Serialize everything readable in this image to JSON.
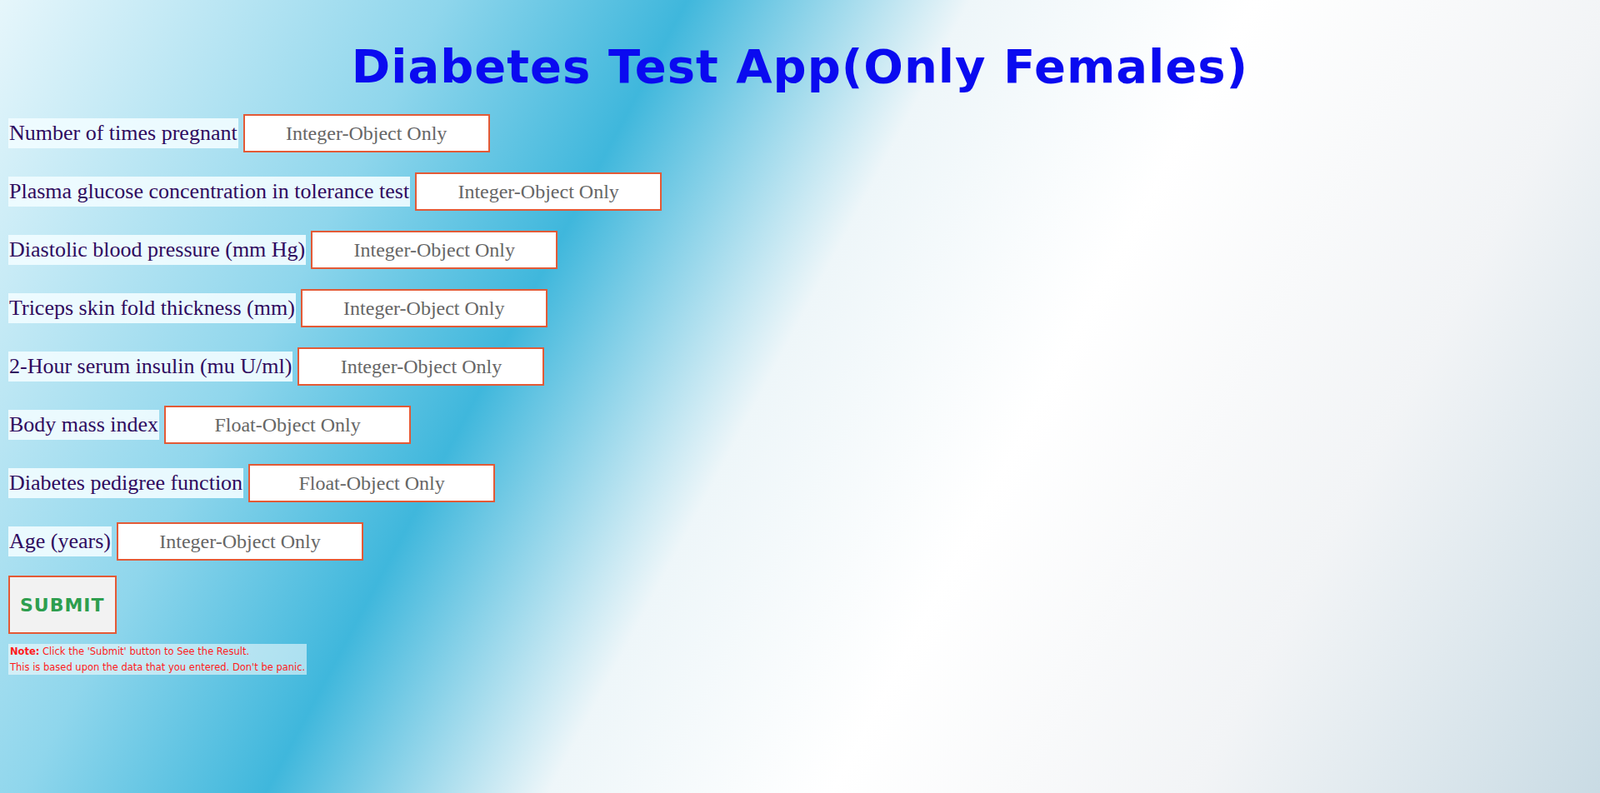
{
  "title": "Diabetes Test App(Only Females)",
  "fields": [
    {
      "label": "Number of times pregnant",
      "placeholder": "Integer-Object Only"
    },
    {
      "label": "Plasma glucose concentration in tolerance test",
      "placeholder": "Integer-Object Only"
    },
    {
      "label": "Diastolic blood pressure (mm Hg)",
      "placeholder": "Integer-Object Only"
    },
    {
      "label": "Triceps skin fold thickness (mm)",
      "placeholder": "Integer-Object Only"
    },
    {
      "label": "2-Hour serum insulin (mu U/ml)",
      "placeholder": "Integer-Object Only"
    },
    {
      "label": "Body mass index",
      "placeholder": "Float-Object Only"
    },
    {
      "label": "Diabetes pedigree function",
      "placeholder": "Float-Object Only"
    },
    {
      "label": "Age (years)",
      "placeholder": "Integer-Object Only"
    }
  ],
  "submit": "SUBMIT",
  "note": {
    "prefix": "Note:",
    "line1": " Click the 'Submit' button to See the Result.",
    "line2": "This is based upon the data that you entered. Don't be panic."
  }
}
